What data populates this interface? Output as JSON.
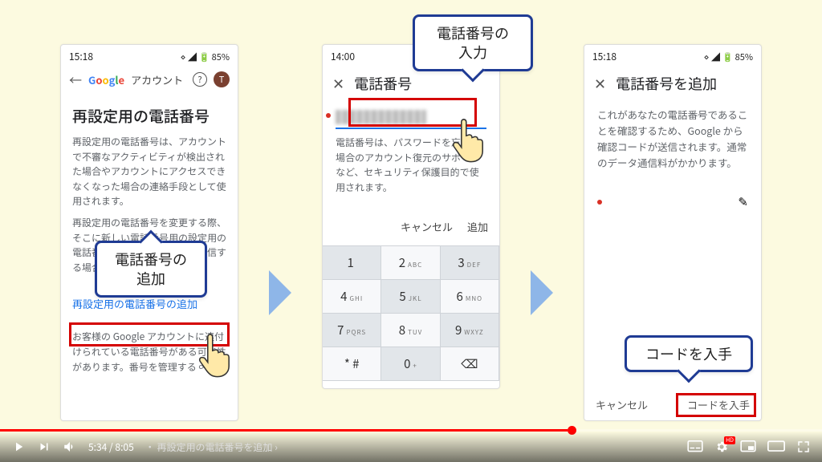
{
  "player": {
    "time_current": "5:34",
    "time_total": "8:05",
    "chapter_sep": "・",
    "chapter": "再設定用の電話番号を追加",
    "chevron": "›"
  },
  "callouts": {
    "add_phone": "電話番号の\n追加",
    "enter_phone": "電話番号の\n入力",
    "get_code": "コードを入手"
  },
  "phone1": {
    "status_time": "15:18",
    "status_mail": "✉",
    "status_right": "⋄ ◢ 🔋 85%",
    "back": "←",
    "g_text": "Google",
    "account_label": "アカウント",
    "avatar": "T",
    "heading": "再設定用の電話番号",
    "body": "再設定用の電話番号は、アカウントで不審なアクティビティが検出された場合やアカウントにアクセスできなくなった場合の連絡手段として使用されます。",
    "body2_partial": "再設定用の電話番号を変更する際、そこに新しい電話番号用の設定用の電話番号が反映されるまでを送信する場合があります。",
    "link": "再設定用の電話番号の追加",
    "footer": "お客様の Google アカウントに連付けられている電話番号がある可能性があります。番号を管理する ∞"
  },
  "phone2": {
    "status_time": "14:00",
    "close": "✕",
    "title": "電話番号",
    "body": "電話番号は、パスワードを忘れた場合のアカウント復元のサポートなど、セキュリティ保護目的で使用されます。",
    "cancel": "キャンセル",
    "add": "追加",
    "keys": [
      {
        "n": "1",
        "l": ""
      },
      {
        "n": "2",
        "l": "ABC"
      },
      {
        "n": "3",
        "l": "DEF"
      },
      {
        "n": "4",
        "l": "GHI"
      },
      {
        "n": "5",
        "l": "JKL"
      },
      {
        "n": "6",
        "l": "MNO"
      },
      {
        "n": "7",
        "l": "PQRS"
      },
      {
        "n": "8",
        "l": "TUV"
      },
      {
        "n": "9",
        "l": "WXYZ"
      },
      {
        "n": "* #",
        "l": ""
      },
      {
        "n": "0",
        "l": "+"
      },
      {
        "n": "⌫",
        "l": ""
      }
    ]
  },
  "phone3": {
    "status_time": "15:18",
    "status_mail": "✉",
    "status_right": "⋄ ◢ 🔋 85%",
    "close": "✕",
    "title": "電話番号を追加",
    "body": "これがあなたの電話番号であることを確認するため、Google から確認コードが送信されます。通常のデータ通信料がかかります。",
    "pen": "✎",
    "cancel": "キャンセル",
    "get_code": "コードを入手"
  }
}
